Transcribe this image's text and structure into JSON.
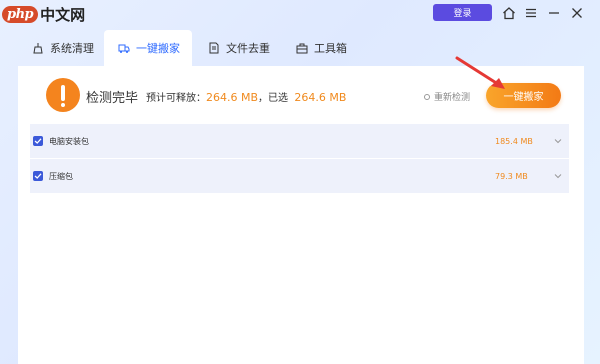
{
  "app": {
    "logo_php": "php",
    "logo_cn": "中文网",
    "login_label": "登录"
  },
  "tabs": [
    {
      "label": "系统清理",
      "icon": "broom-icon",
      "active": false
    },
    {
      "label": "一键搬家",
      "icon": "truck-icon",
      "active": true
    },
    {
      "label": "文件去重",
      "icon": "file-icon",
      "active": false
    },
    {
      "label": "工具箱",
      "icon": "toolbox-icon",
      "active": false
    }
  ],
  "status": {
    "title": "检测完毕",
    "releasable_prefix": "预计可释放：",
    "releasable_value": "264.6 MB",
    "selected_prefix": "，已选",
    "selected_value": "264.6 MB"
  },
  "rescan_label": "重新检测",
  "main_button_label": "一键搬家",
  "items": [
    {
      "label": "电脑安装包",
      "size": "185.4 MB",
      "checked": true
    },
    {
      "label": "压缩包",
      "size": "79.3 MB",
      "checked": true
    }
  ],
  "colors": {
    "accent": "#2f6bff",
    "orange": "#f08a1e",
    "login": "#5b4be0",
    "checkbox": "#3b59d9"
  }
}
